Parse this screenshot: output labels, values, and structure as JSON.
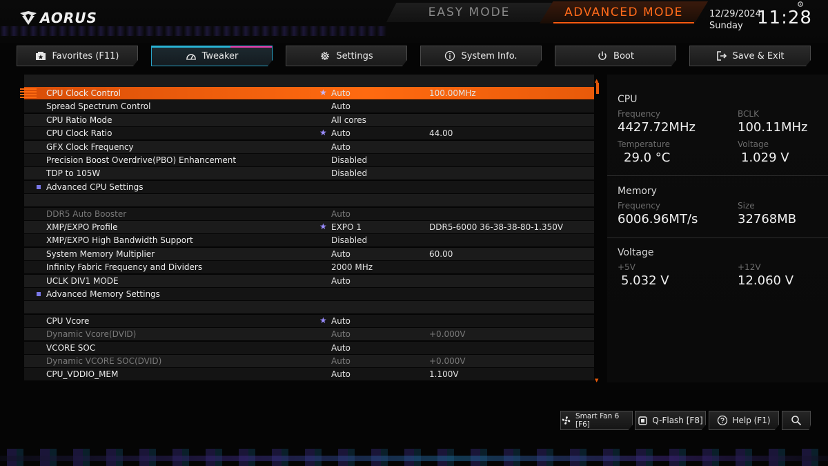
{
  "header": {
    "brand": "AORUS",
    "easy_mode": "EASY MODE",
    "advanced_mode": "ADVANCED MODE",
    "date": "12/29/2024",
    "day": "Sunday",
    "time": "11:28"
  },
  "tabs": [
    {
      "label": "Favorites (F11)",
      "icon": "favorites-icon",
      "active": false
    },
    {
      "label": "Tweaker",
      "icon": "gauge-icon",
      "active": true
    },
    {
      "label": "Settings",
      "icon": "gear-icon",
      "active": false
    },
    {
      "label": "System Info.",
      "icon": "info-icon",
      "active": false
    },
    {
      "label": "Boot",
      "icon": "power-icon",
      "active": false
    },
    {
      "label": "Save & Exit",
      "icon": "exit-icon",
      "active": false
    }
  ],
  "settings": [
    {
      "label": "CPU Clock Control",
      "value": "Auto",
      "value2": "100.00MHz",
      "star": true
    },
    {
      "label": "Spread Spectrum Control",
      "value": "Auto",
      "value2": ""
    },
    {
      "label": "CPU Ratio Mode",
      "value": "All cores",
      "value2": ""
    },
    {
      "label": "CPU Clock Ratio",
      "value": "Auto",
      "value2": "44.00",
      "star": true
    },
    {
      "label": "GFX Clock Frequency",
      "value": "Auto",
      "value2": ""
    },
    {
      "label": "Precision Boost Overdrive(PBO) Enhancement",
      "value": "Disabled",
      "value2": ""
    },
    {
      "label": "TDP to 105W",
      "value": "Disabled",
      "value2": ""
    },
    {
      "label": "Advanced CPU Settings",
      "value": "",
      "value2": ""
    },
    {
      "label": "",
      "value": "",
      "value2": ""
    },
    {
      "label": "DDR5 Auto Booster",
      "value": "Auto",
      "value2": ""
    },
    {
      "label": "XMP/EXPO Profile",
      "value": "EXPO 1",
      "value2": "DDR5-6000 36-38-38-80-1.350V",
      "star": true
    },
    {
      "label": "XMP/EXPO High Bandwidth Support",
      "value": "Disabled",
      "value2": ""
    },
    {
      "label": "System Memory Multiplier",
      "value": "Auto",
      "value2": "60.00"
    },
    {
      "label": "Infinity Fabric Frequency and Dividers",
      "value": "2000 MHz",
      "value2": ""
    },
    {
      "label": "UCLK DIV1 MODE",
      "value": "Auto",
      "value2": ""
    },
    {
      "label": "Advanced Memory Settings",
      "value": "",
      "value2": ""
    },
    {
      "label": "",
      "value": "",
      "value2": ""
    },
    {
      "label": "CPU Vcore",
      "value": "Auto",
      "value2": "",
      "star": true
    },
    {
      "label": "Dynamic Vcore(DVID)",
      "value": "Auto",
      "value2": "+0.000V"
    },
    {
      "label": "VCORE SOC",
      "value": "Auto",
      "value2": ""
    },
    {
      "label": "Dynamic VCORE SOC(DVID)",
      "value": "Auto",
      "value2": "+0.000V"
    },
    {
      "label": "CPU_VDDIO_MEM",
      "value": "Auto",
      "value2": "1.100V"
    }
  ],
  "info": {
    "cpu": {
      "title": "CPU",
      "frequency_label": "Frequency",
      "frequency": "4427.72MHz",
      "bclk_label": "BCLK",
      "bclk": "100.11MHz",
      "temperature_label": "Temperature",
      "temperature": "29.0 °C",
      "voltage_label": "Voltage",
      "voltage": "1.029 V"
    },
    "memory": {
      "title": "Memory",
      "frequency_label": "Frequency",
      "frequency": "6006.96MT/s",
      "size_label": "Size",
      "size": "32768MB"
    },
    "voltage": {
      "title": "Voltage",
      "p5v_label": "+5V",
      "p5v": "5.032 V",
      "p12v_label": "+12V",
      "p12v": "12.060 V"
    }
  },
  "bottom_buttons": {
    "smart_fan": "Smart Fan 6 [F6]",
    "qflash": "Q-Flash [F8]",
    "help": "Help (F1)"
  },
  "colors": {
    "accent": "#ff6a10",
    "tab_active_cyan": "#28b6d8",
    "tab_active_pink": "#e83aa8",
    "star": "#9a8cff"
  }
}
